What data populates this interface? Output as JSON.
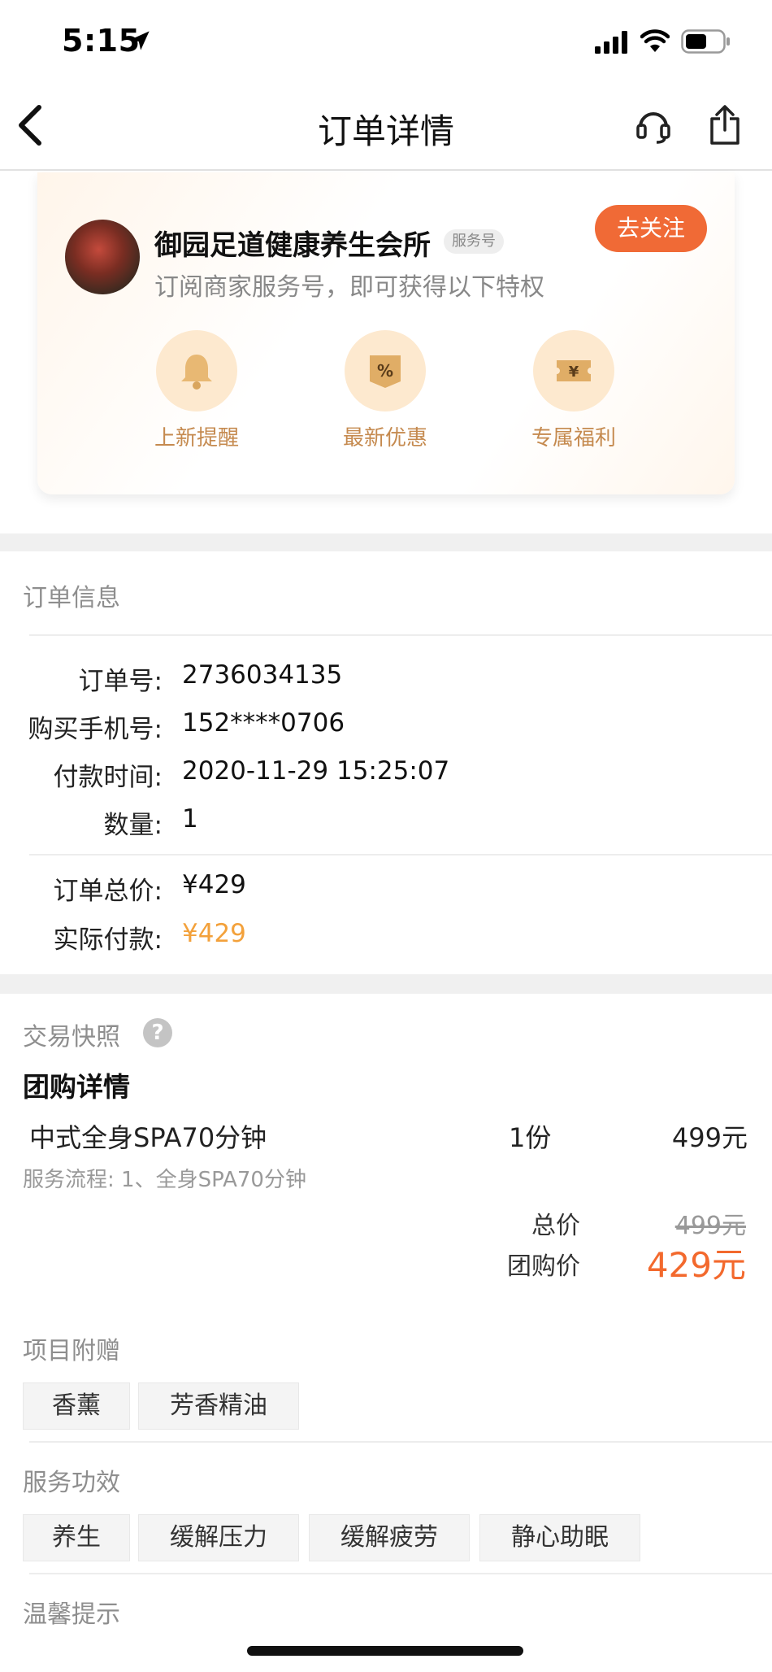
{
  "status_bar": {
    "time": "5:15"
  },
  "nav": {
    "title": "订单详情"
  },
  "shop": {
    "name": "御园足道健康养生会所",
    "badge": "服务号",
    "subtitle": "订阅商家服务号，即可获得以下特权",
    "follow_label": "去关注",
    "perks": [
      {
        "label": "上新提醒",
        "icon": "bell-icon"
      },
      {
        "label": "最新优惠",
        "icon": "percent-icon"
      },
      {
        "label": "专属福利",
        "icon": "yen-ticket-icon"
      }
    ]
  },
  "order_info": {
    "title": "订单信息",
    "rows": [
      {
        "label": "订单号:",
        "value": "2736034135"
      },
      {
        "label": "购买手机号:",
        "value": "152****0706"
      },
      {
        "label": "付款时间:",
        "value": "2020-11-29 15:25:07"
      },
      {
        "label": "数量:",
        "value": "1"
      }
    ],
    "total_label": "订单总价:",
    "total_value": "¥429",
    "paid_label": "实际付款:",
    "paid_value": "¥429"
  },
  "snapshot": {
    "title": "交易快照",
    "help_glyph": "?",
    "group_title": "团购详情",
    "item_name": "中式全身SPA70分钟",
    "item_qty": "1份",
    "item_price": "499元",
    "item_desc": "服务流程: 1、全身SPA70分钟",
    "total_label": "总价",
    "total_value": "499元",
    "group_price_label": "团购价",
    "group_price_value": "429元",
    "gifts_title": "项目附赠",
    "gifts": [
      "香薰",
      "芳香精油"
    ],
    "effects_title": "服务功效",
    "effects": [
      "养生",
      "缓解压力",
      "缓解疲劳",
      "静心助眠"
    ],
    "tips_title": "温馨提示"
  },
  "colors": {
    "accent_orange": "#f06a36",
    "price_orange": "#f3a13b",
    "perk_gold": "#c58a4f"
  }
}
